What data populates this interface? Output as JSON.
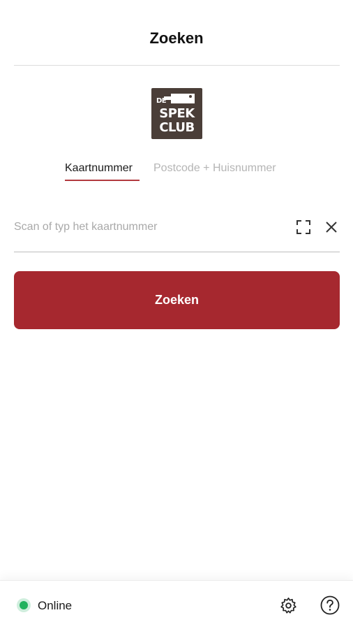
{
  "header": {
    "title": "Zoeken"
  },
  "logo": {
    "line1": "DE",
    "line2": "SPEK",
    "line3": "CLUB",
    "icon": "cleaver-icon"
  },
  "tabs": [
    {
      "label": "Kaartnummer",
      "active": true
    },
    {
      "label": "Postcode + Huisnummer",
      "active": false
    }
  ],
  "search": {
    "value": "",
    "placeholder": "Scan of typ het kaartnummer",
    "scan_icon": "scan-icon",
    "clear_icon": "close-icon"
  },
  "actions": {
    "search_label": "Zoeken"
  },
  "footer": {
    "status_label": "Online",
    "settings_icon": "gear-icon",
    "help_icon": "question-icon"
  },
  "colors": {
    "brand": "#a6282f",
    "tab_underline": "#b23a3f",
    "logo_bg": "#4a3e38",
    "status_online": "#21b25d"
  }
}
